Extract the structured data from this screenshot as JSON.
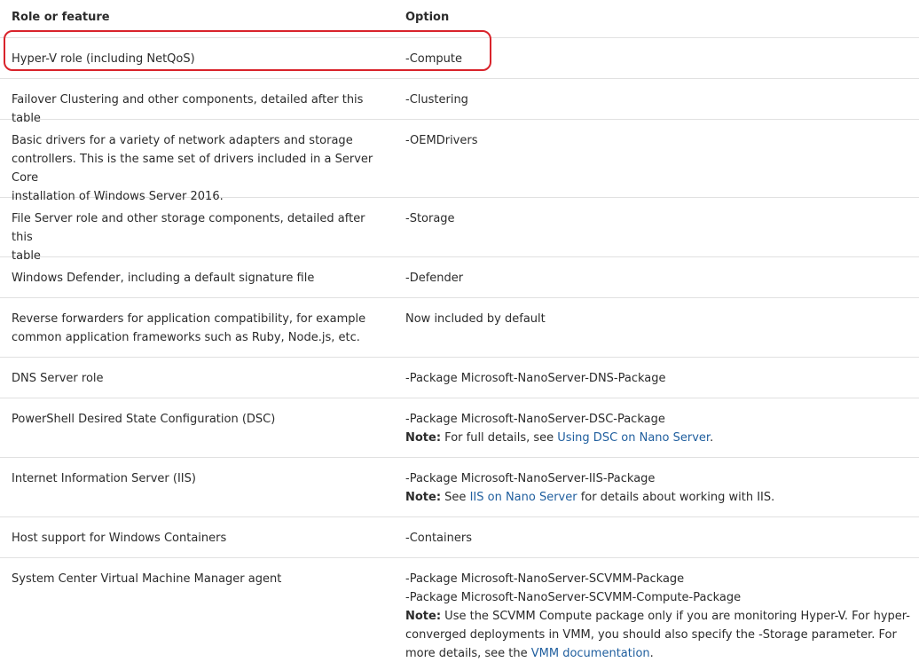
{
  "table": {
    "header": {
      "col1": "Role or feature",
      "col2": "Option"
    },
    "rows": [
      {
        "feature": "Hyper-V role (including NetQoS)",
        "option": "-Compute"
      },
      {
        "feature": "Failover Clustering and other components, detailed after this table",
        "option": "-Clustering"
      },
      {
        "feature_lines": [
          "Basic drivers for a variety of network adapters and storage",
          "controllers. This is the same set of drivers included in a Server Core",
          "installation of Windows Server 2016."
        ],
        "option": "-OEMDrivers"
      },
      {
        "feature_lines": [
          "File Server role and other storage components, detailed after this",
          "table"
        ],
        "option": "-Storage"
      },
      {
        "feature": "Windows Defender, including a default signature file",
        "option": "-Defender"
      },
      {
        "feature_lines": [
          "Reverse forwarders for application compatibility, for example",
          "common application frameworks such as Ruby, Node.js, etc."
        ],
        "option": "Now included by default"
      },
      {
        "feature": "DNS Server role",
        "option": "-Package Microsoft-NanoServer-DNS-Package"
      },
      {
        "feature": "PowerShell Desired State Configuration (DSC)",
        "option": "-Package Microsoft-NanoServer-DSC-Package",
        "note_label": "Note:",
        "note_before": " For full details, see ",
        "note_link": "Using DSC on Nano Server",
        "note_after": "."
      },
      {
        "feature": "Internet Information Server (IIS)",
        "option": "-Package Microsoft-NanoServer-IIS-Package",
        "note_label": "Note:",
        "note_before": " See ",
        "note_link": "IIS on Nano Server",
        "note_after": " for details about working with IIS."
      },
      {
        "feature": "Host support for Windows Containers",
        "option": "-Containers"
      },
      {
        "feature": "System Center Virtual Machine Manager agent",
        "option_lines": [
          "-Package Microsoft-NanoServer-SCVMM-Package",
          "-Package Microsoft-NanoServer-SCVMM-Compute-Package"
        ],
        "note_label": "Note:",
        "note_lines": [
          " Use the SCVMM Compute package only if you are monitoring Hyper-V. For hyper-",
          "converged deployments in VMM, you should also specify the -Storage parameter. For",
          "more details, see the "
        ],
        "note_link": "VMM documentation",
        "note_after": "."
      }
    ]
  },
  "colors": {
    "highlight": "#d9232b",
    "link": "#1f5e9e",
    "text": "#2b2b2b",
    "divider": "#e1e1e1"
  }
}
